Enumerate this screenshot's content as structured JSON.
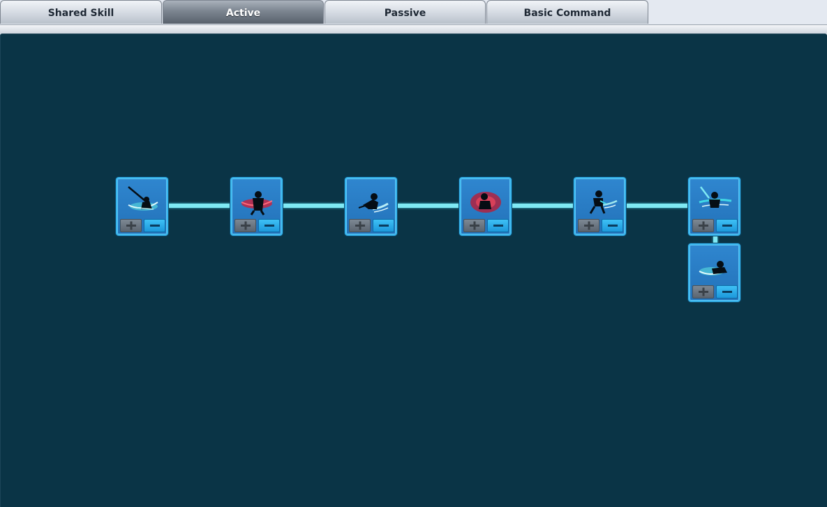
{
  "tabs": [
    {
      "label": "Shared Skill",
      "active": false
    },
    {
      "label": "Active",
      "active": true
    },
    {
      "label": "Passive",
      "active": false
    },
    {
      "label": "Basic Command",
      "active": false
    }
  ],
  "skill_tree": {
    "nodes": [
      {
        "name": "skill-1",
        "icon": "sword-slash-icon",
        "effect_color": "#5ce6e0"
      },
      {
        "name": "skill-2",
        "icon": "crimson-slash-icon",
        "effect_color": "#d21f3a"
      },
      {
        "name": "skill-3",
        "icon": "dash-strike-icon",
        "effect_color": "#b9eef7"
      },
      {
        "name": "skill-4",
        "icon": "blood-burst-icon",
        "effect_color": "#c4162c"
      },
      {
        "name": "skill-5",
        "icon": "rising-strike-icon",
        "effect_color": "#9fe8ee"
      },
      {
        "name": "skill-6",
        "icon": "blade-wave-icon",
        "effect_color": "#41d8e6"
      },
      {
        "name": "skill-7",
        "icon": "ground-slide-icon",
        "effect_color": "#5ce6e0"
      }
    ],
    "controls": {
      "increase_icon": "plus-icon",
      "decrease_icon": "minus-icon"
    }
  },
  "colors": {
    "panel_background": "#0a3446",
    "node_fill": "#2372b9",
    "node_border": "#38b6ee",
    "connector": "#7fe9f4",
    "plus_button": "#6b7580",
    "minus_button": "#2aaee8"
  }
}
